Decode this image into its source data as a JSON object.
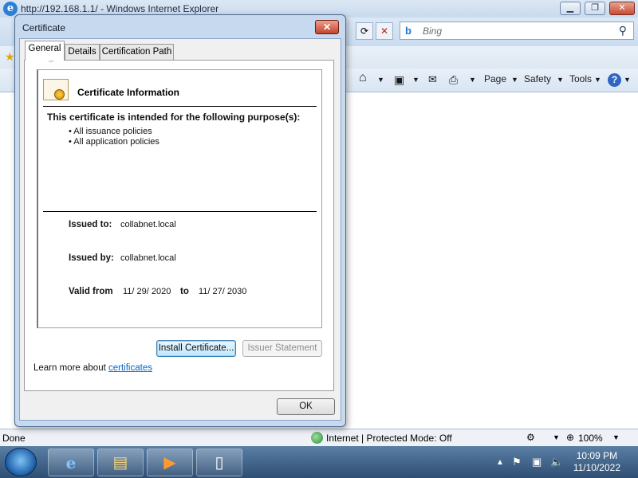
{
  "browser": {
    "title": "http://192.168.1.1/ - Windows Internet Explorer",
    "search_placeholder": "Bing",
    "commands": [
      "Page",
      "Safety",
      "Tools"
    ],
    "status_left": "Done",
    "status_zone": "Internet | Protected Mode: Off",
    "zoom": "100%"
  },
  "taskbar": {
    "time": "10:09 PM",
    "date": "11/10/2022"
  },
  "dialog": {
    "title": "Certificate",
    "tabs": [
      "General",
      "Details",
      "Certification Path"
    ],
    "heading": "Certificate Information",
    "purpose_heading": "This certificate is intended for the following purpose(s):",
    "purposes": [
      "• All issuance policies",
      "• All application policies"
    ],
    "issued_to_label": "Issued to:",
    "issued_to_value": "collabnet.local",
    "issued_by_label": "Issued by:",
    "issued_by_value": "collabnet.local",
    "valid_from_label": "Valid from",
    "valid_from_value": "11/ 29/ 2020",
    "valid_to_label": "to",
    "valid_to_value": "11/ 27/ 2030",
    "install_button": "Install Certificate...",
    "issuer_button": "Issuer Statement",
    "learn_more_text": "Learn more about",
    "learn_more_link": "certificates",
    "ok_button": "OK"
  },
  "colors": {
    "link": "#0066cc",
    "accent": "#c7d9ef"
  }
}
